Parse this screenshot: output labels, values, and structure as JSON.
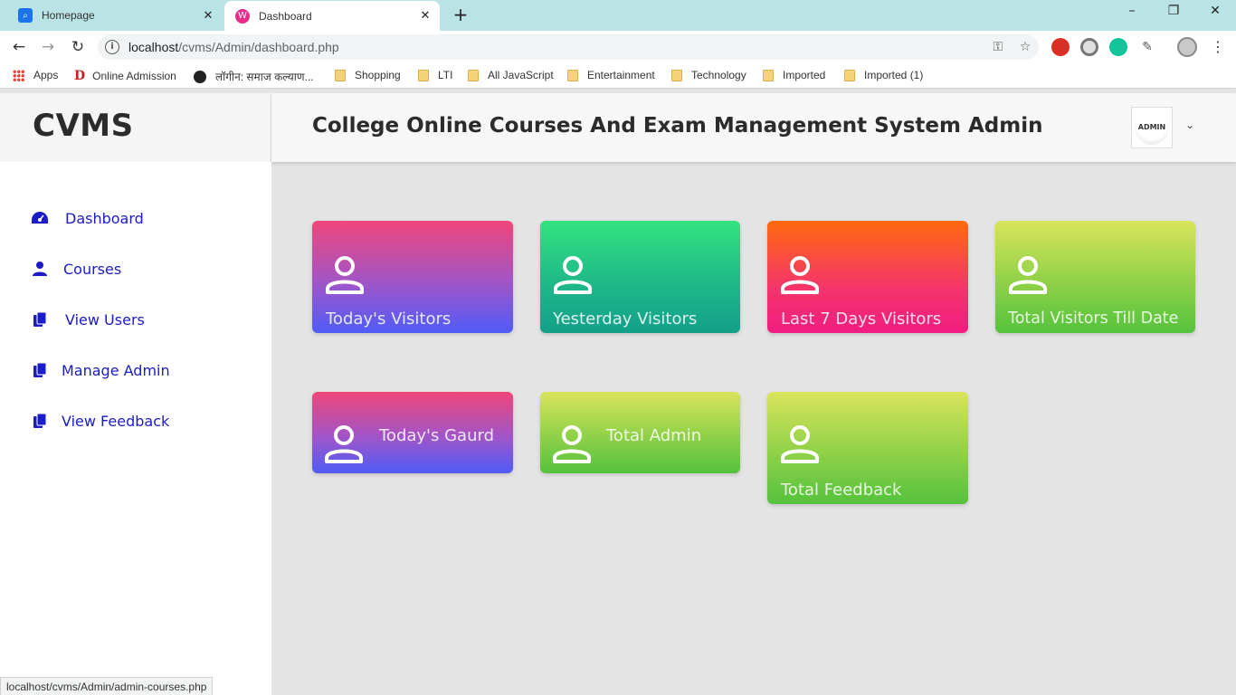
{
  "browser": {
    "tabs": [
      {
        "title": "Homepage",
        "active": false
      },
      {
        "title": "Dashboard",
        "active": true
      }
    ],
    "url": {
      "host": "localhost",
      "path": "/cvms/Admin/dashboard.php"
    },
    "bookmarks": [
      "Apps",
      "Online Admission",
      "लॉगीन: समाज कल्याण...",
      "Shopping",
      "LTI",
      "All JavaScript",
      "Entertainment",
      "Technology",
      "Imported",
      "Imported (1)"
    ],
    "status_url": "localhost/cvms/Admin/admin-courses.php"
  },
  "app": {
    "brand": "CVMS",
    "title": "College Online Courses And Exam Management System Admin",
    "avatar_text": "ADMIN"
  },
  "sidebar": {
    "items": [
      {
        "label": "Dashboard",
        "icon": "tachometer-icon"
      },
      {
        "label": "Courses",
        "icon": "user-icon"
      },
      {
        "label": "View Users",
        "icon": "copy-icon"
      },
      {
        "label": "Manage Admin",
        "icon": "copy-icon"
      },
      {
        "label": "View Feedback",
        "icon": "copy-icon"
      }
    ]
  },
  "cards": [
    {
      "label": "Today's Visitors",
      "gradient": "pink"
    },
    {
      "label": "Yesterday Visitors",
      "gradient": "green"
    },
    {
      "label": "Last 7 Days Visitors",
      "gradient": "orange"
    },
    {
      "label": "Total Visitors Till Date",
      "gradient": "lime"
    },
    {
      "label": "Today's Gaurd",
      "gradient": "pink"
    },
    {
      "label": "Total Admin",
      "gradient": "lime"
    },
    {
      "label": "Total Feedback",
      "gradient": "lime"
    }
  ],
  "colors": {
    "accent": "#1b1bc8",
    "pink": "#f0467a",
    "blue": "#4f5cf7",
    "green": "#33e37f",
    "orange": "#ff6a0e",
    "lime": "#8fd148"
  }
}
